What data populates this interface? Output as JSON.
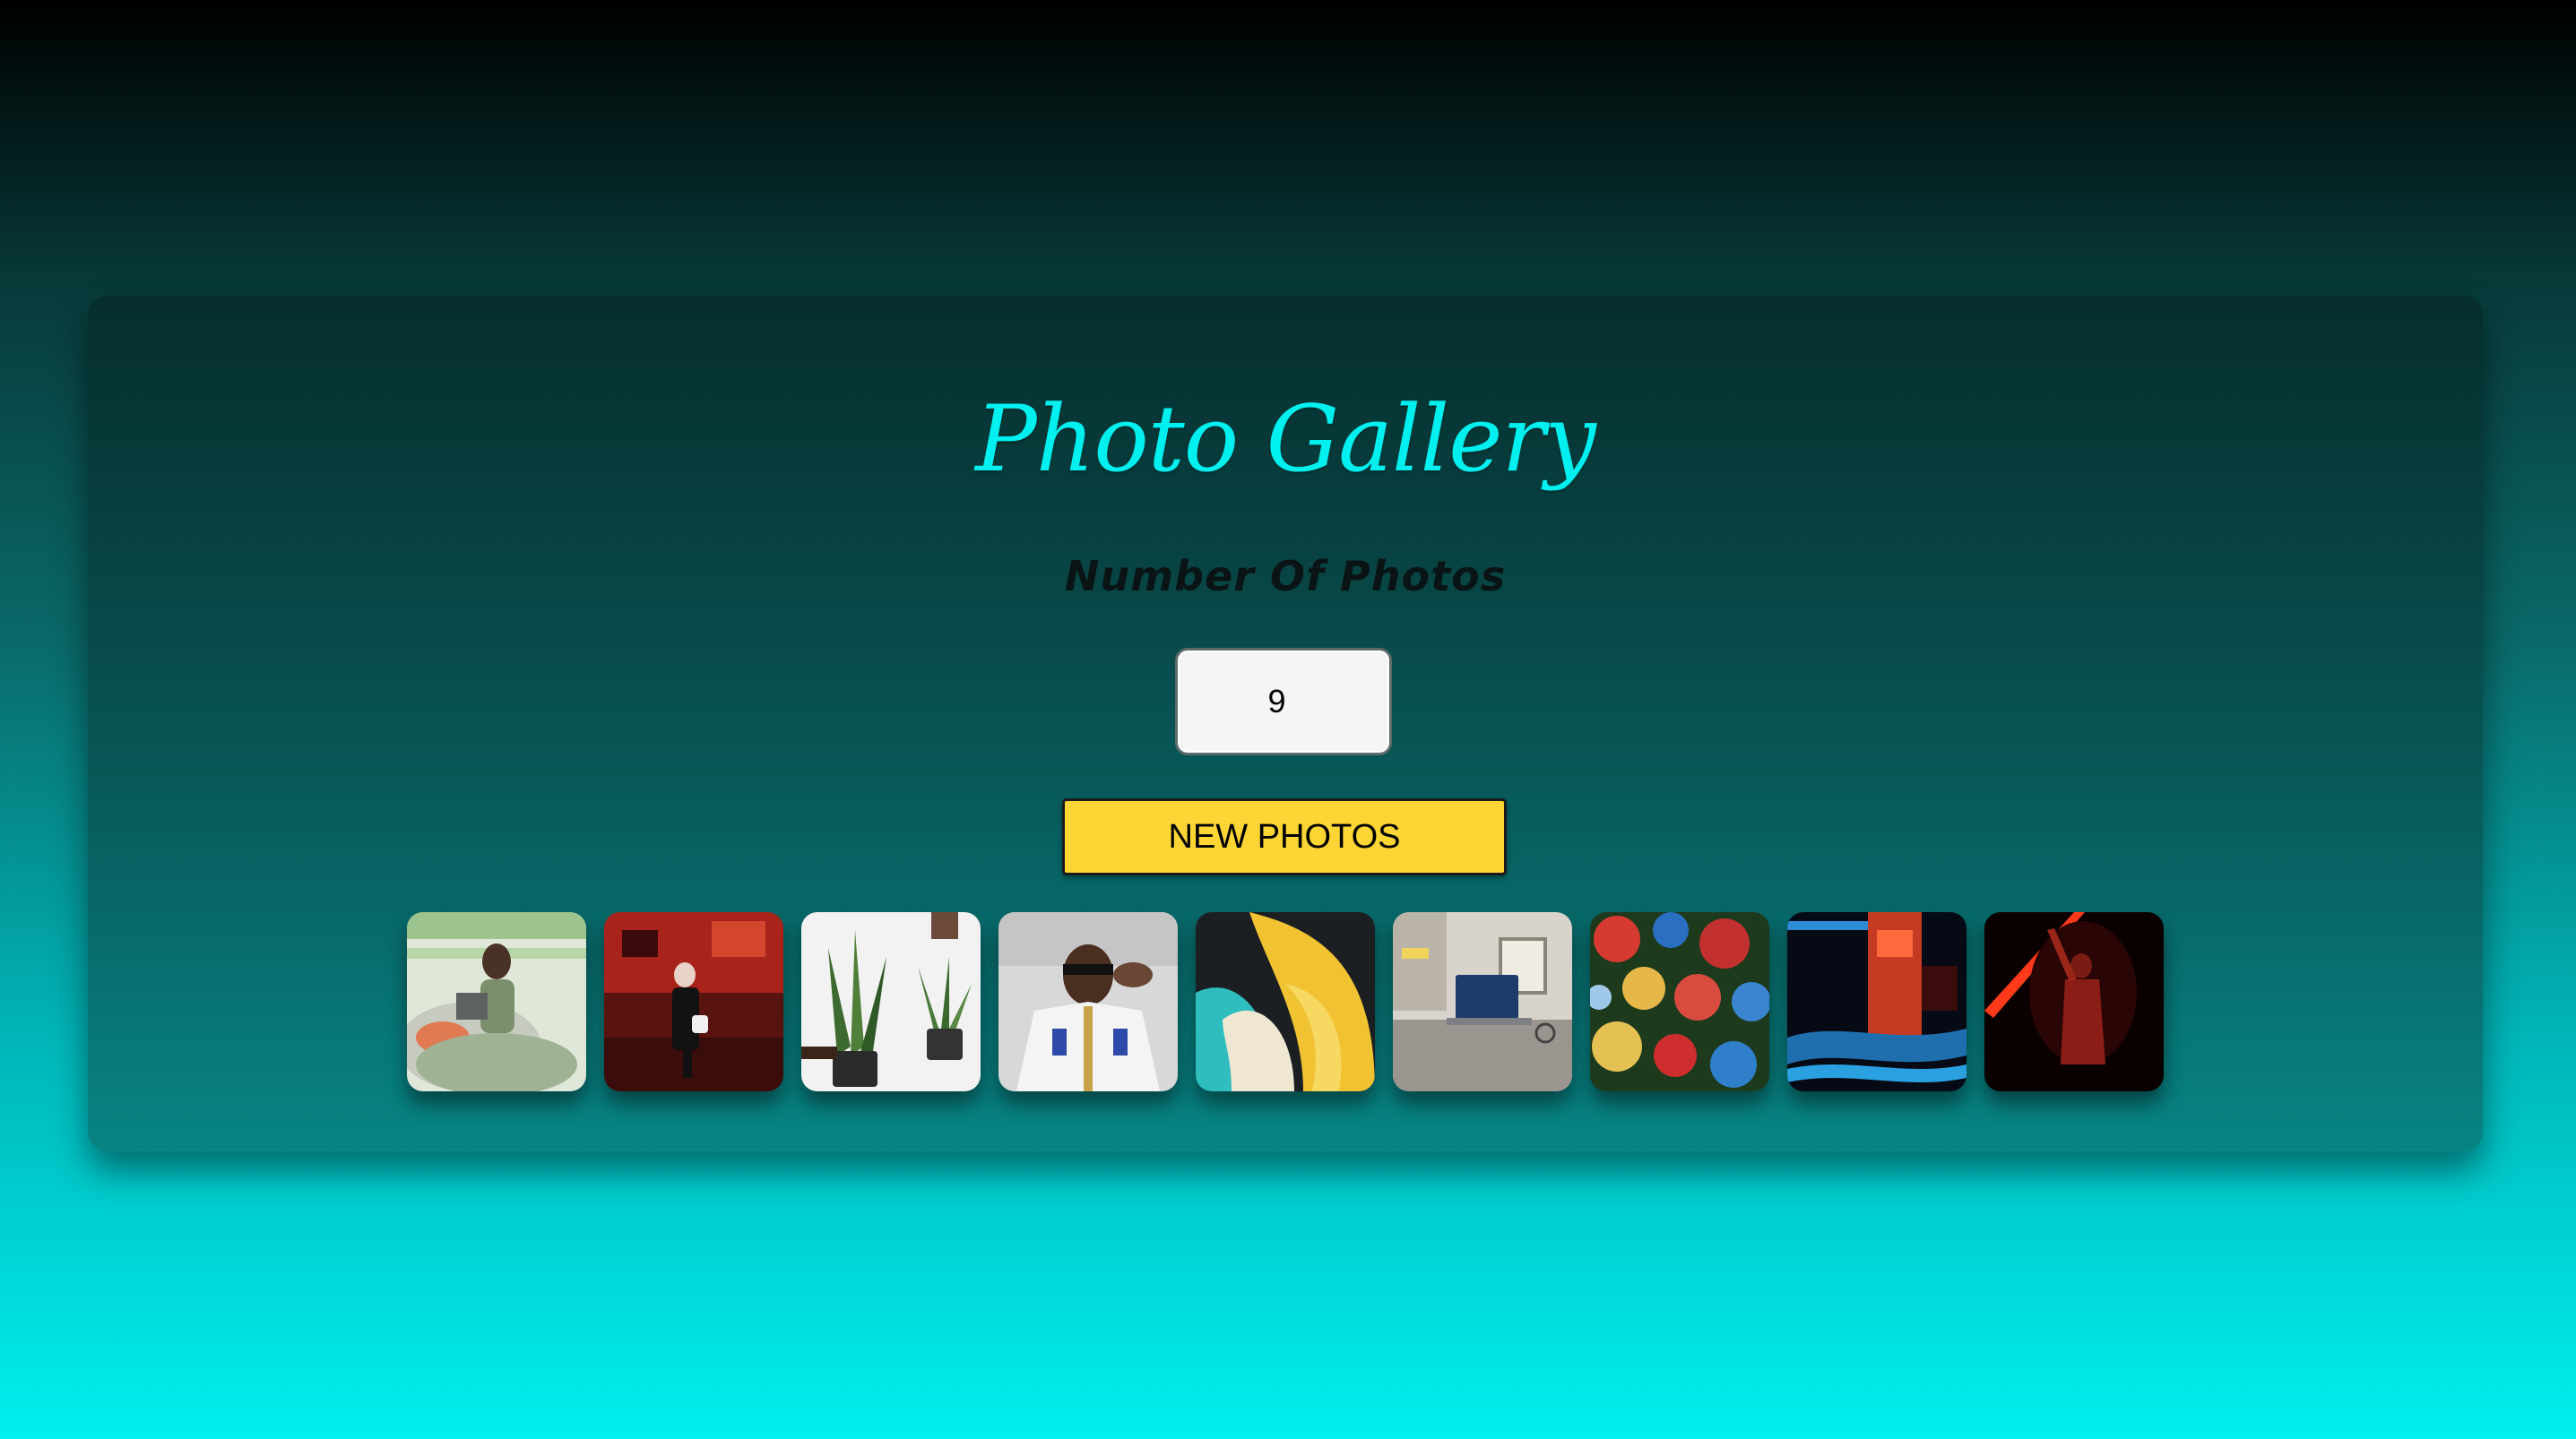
{
  "gallery": {
    "title": "Photo Gallery",
    "count_label": "Number Of Photos",
    "count_value": "9",
    "new_photos_label": "NEW PHOTOS"
  },
  "photos": [
    {
      "subject": "woman-with-laptop-on-couch"
    },
    {
      "subject": "person-walking-red-street"
    },
    {
      "subject": "snake-plants-in-pots"
    },
    {
      "subject": "man-in-white-jacket"
    },
    {
      "subject": "abstract-yellow-waves"
    },
    {
      "subject": "laptop-on-desk"
    },
    {
      "subject": "christmas-ornaments"
    },
    {
      "subject": "neon-city-night"
    },
    {
      "subject": "person-with-red-light"
    }
  ],
  "colors": {
    "title": "#00f0f0",
    "button": "#fdd535",
    "background_top": "#000000",
    "background_bottom": "#00efef"
  }
}
